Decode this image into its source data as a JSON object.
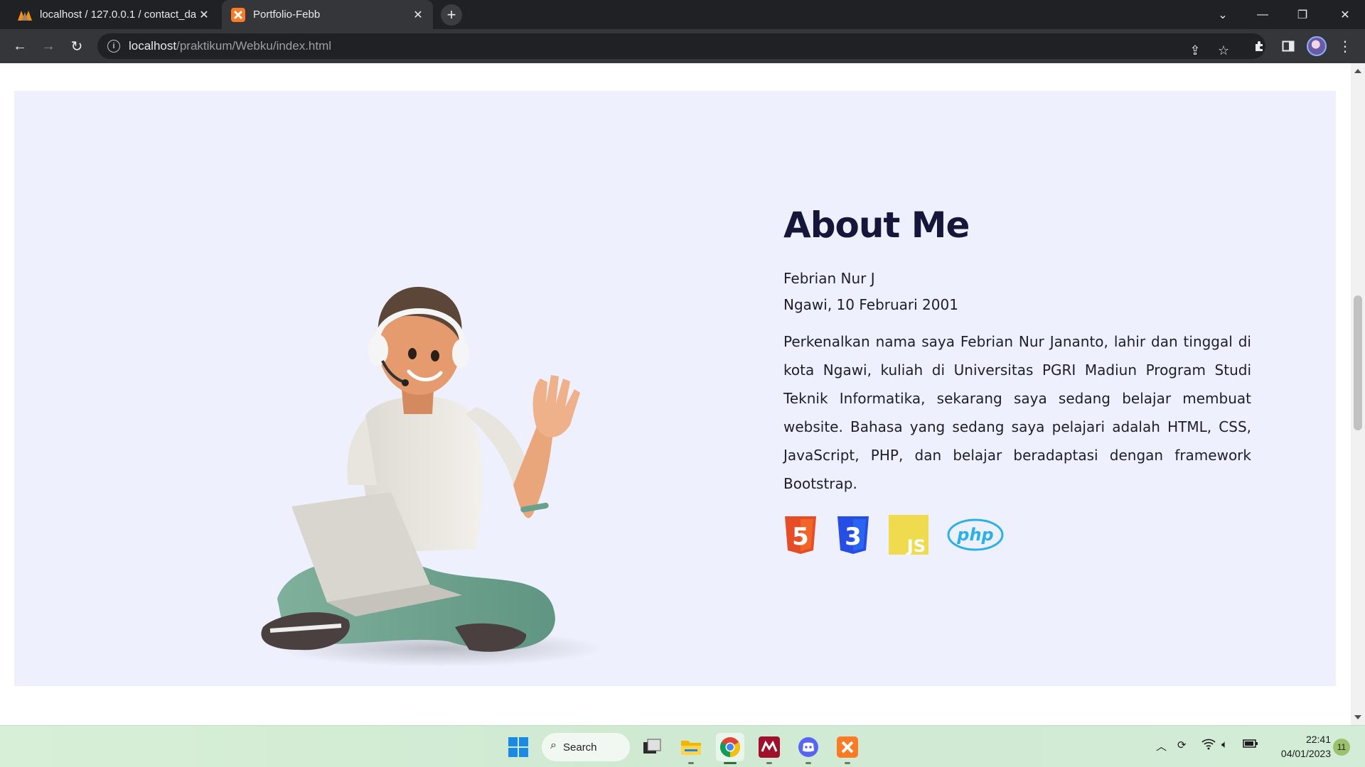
{
  "browser": {
    "tabs": [
      {
        "title": "localhost / 127.0.0.1 / contact_da",
        "icon": "phpmyadmin-icon",
        "active": false
      },
      {
        "title": "Portfolio-Febb",
        "icon": "xampp-icon",
        "active": true
      }
    ],
    "new_tab_label": "+",
    "url_host": "localhost",
    "url_path": "/praktikum/Webku/index.html"
  },
  "about": {
    "title": "About Me",
    "name": "Febrian Nur J",
    "birth": "Ngawi, 10 Februari 2001",
    "description": "Perkenalkan nama saya Febrian Nur Jananto, lahir dan tinggal di kota Ngawi, kuliah di Universitas PGRI Madiun Program Studi Teknik Informatika, sekarang saya sedang belajar membuat website. Bahasa yang sedang saya pelajari adalah HTML, CSS, JavaScript, PHP, dan belajar beradaptasi dengan framework Bootstrap.",
    "skills": [
      {
        "icon": "html5-icon",
        "label": "5",
        "color": "#e44d26"
      },
      {
        "icon": "css3-icon",
        "label": "3",
        "color": "#264de4"
      },
      {
        "icon": "js-icon",
        "label": "JS",
        "color": "#f0db4f"
      },
      {
        "icon": "php-icon",
        "label": "php",
        "color": "#2ab1e8"
      }
    ]
  },
  "taskbar": {
    "search_label": "Search",
    "apps": [
      "start-icon",
      "task-view-icon",
      "file-explorer-icon",
      "chrome-icon",
      "mendeley-icon",
      "discord-icon",
      "xampp-icon"
    ],
    "time": "22:41",
    "date": "04/01/2023",
    "notifications": "11"
  }
}
